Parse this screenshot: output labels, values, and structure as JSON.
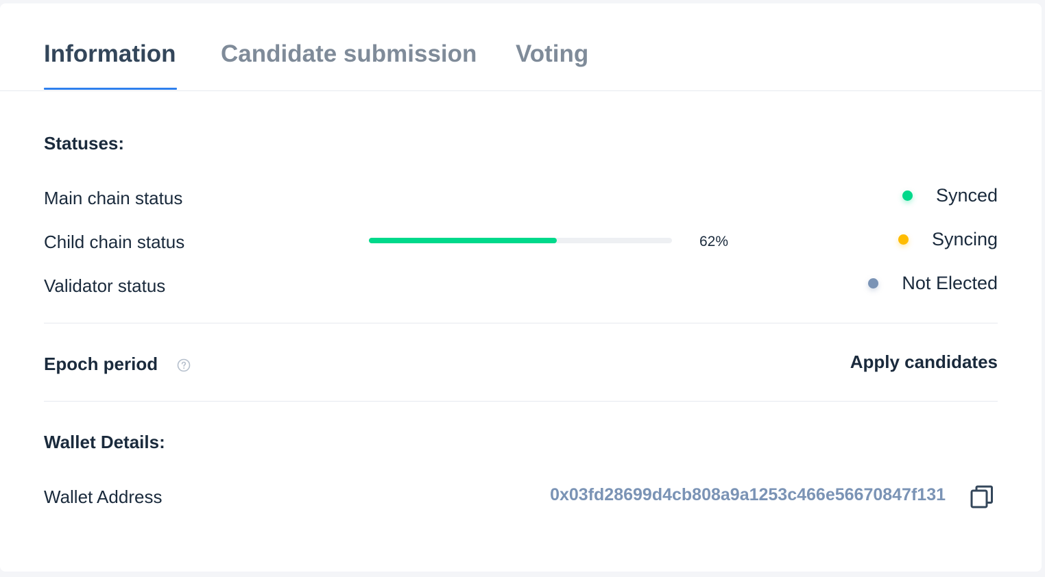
{
  "tabs": [
    {
      "label": "Information",
      "active": true
    },
    {
      "label": "Candidate submission",
      "active": false
    },
    {
      "label": "Voting",
      "active": false
    }
  ],
  "statuses": {
    "title": "Statuses:",
    "rows": [
      {
        "label": "Main chain status",
        "status": "Synced",
        "color": "#00d98b"
      },
      {
        "label": "Child chain status",
        "status": "Syncing",
        "color": "#ffbc00",
        "progress_percent": 62,
        "progress_text": "62%"
      },
      {
        "label": "Validator status",
        "status": "Not Elected",
        "color": "#7a93b5"
      }
    ]
  },
  "epoch": {
    "label": "Epoch period",
    "help_icon": "question-circle-icon",
    "action_label": "Apply candidates"
  },
  "wallet": {
    "title": "Wallet Details:",
    "address_label": "Wallet Address",
    "address": "0x03fd28699d4cb808a9a1253c466e56670847f131",
    "copy_icon": "copy-icon"
  },
  "colors": {
    "accent": "#2f80ed",
    "text_primary": "#1a2a3c",
    "text_muted": "#7f8b99",
    "synced": "#00d98b",
    "syncing": "#ffbc00",
    "not_elected": "#7a93b5"
  }
}
